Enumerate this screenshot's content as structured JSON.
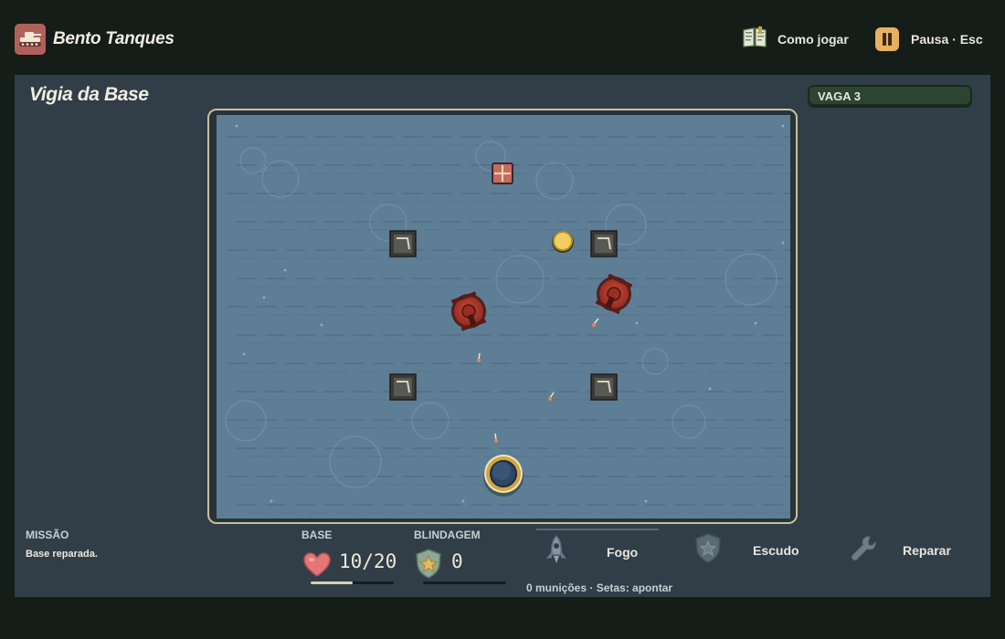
{
  "app": {
    "title": "Bento Tanques",
    "logo_icon": "tank-icon"
  },
  "nav": {
    "help_label": "Como jogar",
    "help_icon": "book-icon",
    "pause_label": "Pausa · Esc",
    "pause_icon": "pause-icon"
  },
  "panel": {
    "title": "Vigia da Base",
    "wave_label": "VAGA 3"
  },
  "mission": {
    "label": "MISSÃO",
    "status": "Base reparada."
  },
  "stats": {
    "base": {
      "label": "BASE",
      "value": "10/20",
      "current": 10,
      "max": 20,
      "icon": "heart-icon"
    },
    "armor": {
      "label": "BLINDAGEM",
      "value": "0",
      "current": 0,
      "icon": "shield-star-icon"
    }
  },
  "actions": {
    "fire": {
      "label": "Fogo",
      "icon": "rocket-icon"
    },
    "shield": {
      "label": "Escudo",
      "icon": "shield-star-icon"
    },
    "repair": {
      "label": "Reparar",
      "icon": "wrench-icon"
    }
  },
  "ammo_hint": "0 munições · Setas: apontar",
  "colors": {
    "background": "#141d17",
    "panel": "#313e48",
    "arena_water": "#5e7e96",
    "enemy_tank": "#b23a2d",
    "accent_gold": "#e7b162",
    "heart": "#e07070",
    "wave_badge": "#2d4430"
  }
}
